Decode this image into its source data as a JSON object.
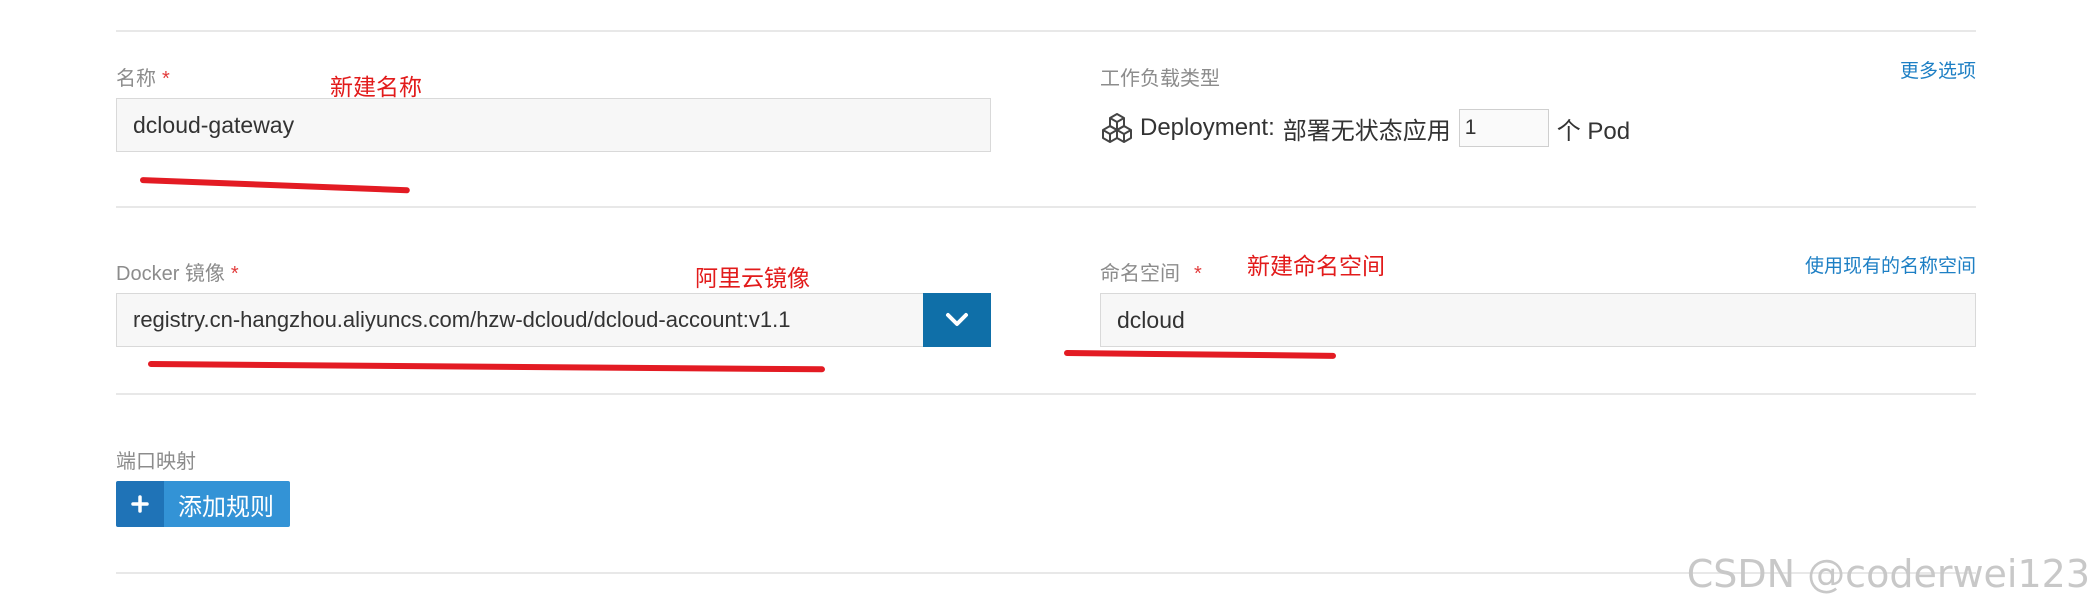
{
  "form": {
    "name": {
      "label": "名称",
      "required_mark": "*",
      "value": "dcloud-gateway",
      "annotation": "新建名称"
    },
    "workload": {
      "label": "工作负载类型",
      "more_options_link": "更多选项",
      "deployment_label": "Deployment:",
      "deployment_desc": "部署无状态应用",
      "pod_count": "1",
      "pod_unit": "个 Pod",
      "icon": "cubes-icon"
    },
    "docker_image": {
      "label": "Docker 镜像",
      "required_mark": "*",
      "value": "registry.cn-hangzhou.aliyuncs.com/hzw-dcloud/dcloud-account:v1.1",
      "annotation": "阿里云镜像",
      "dropdown_icon": "chevron-down-icon"
    },
    "namespace": {
      "label": "命名空间",
      "required_mark": "*",
      "value": "dcloud",
      "annotation": "新建命名空间",
      "use_existing_link": "使用现有的名称空间"
    },
    "port_mapping": {
      "label": "端口映射",
      "add_rule_label": "添加规则",
      "add_icon": "plus-icon"
    }
  },
  "watermark": "CSDN @coderwei123",
  "colors": {
    "link": "#1d7fc4",
    "annotation": "#e21b1b",
    "button_primary": "#0f6fa8",
    "add_button": "#3393d6",
    "required": "#e23b3b"
  }
}
